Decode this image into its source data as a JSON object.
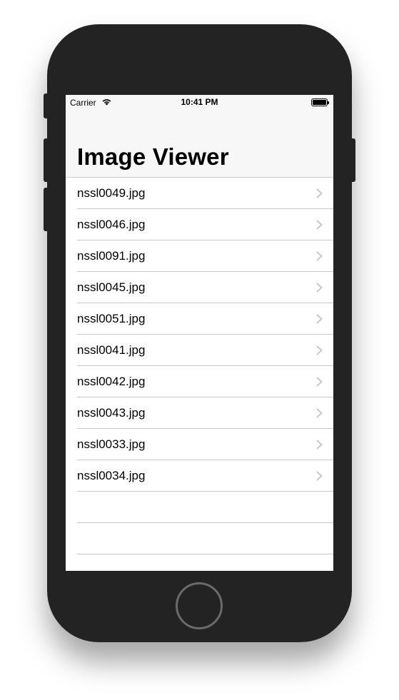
{
  "status_bar": {
    "carrier": "Carrier",
    "time": "10:41 PM",
    "wifi_icon": "wifi-icon",
    "battery_icon": "battery-icon"
  },
  "nav": {
    "title": "Image Viewer"
  },
  "list": {
    "items": [
      {
        "label": "nssl0049.jpg"
      },
      {
        "label": "nssl0046.jpg"
      },
      {
        "label": "nssl0091.jpg"
      },
      {
        "label": "nssl0045.jpg"
      },
      {
        "label": "nssl0051.jpg"
      },
      {
        "label": "nssl0041.jpg"
      },
      {
        "label": "nssl0042.jpg"
      },
      {
        "label": "nssl0043.jpg"
      },
      {
        "label": "nssl0033.jpg"
      },
      {
        "label": "nssl0034.jpg"
      }
    ],
    "disclosure_icon": "chevron-right-icon",
    "separator_color": "#c8c7cc"
  },
  "colors": {
    "device": "#232323",
    "nav_background": "#f7f7f7",
    "chevron": "#c7c7cc"
  }
}
